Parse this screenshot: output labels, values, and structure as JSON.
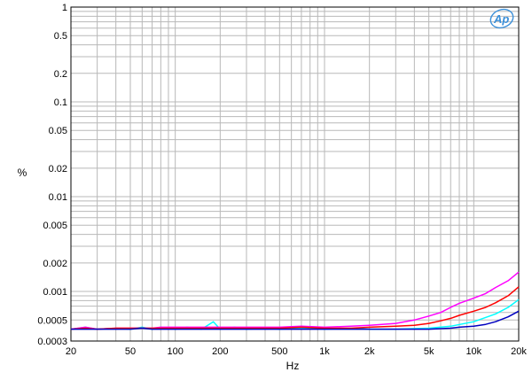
{
  "chart_data": {
    "type": "line",
    "title": "",
    "xlabel": "Hz",
    "ylabel": "%",
    "xscale": "log",
    "yscale": "log",
    "xlim": [
      20,
      20000
    ],
    "ylim": [
      0.0003,
      1
    ],
    "grid": true,
    "logo": "Ap",
    "x_ticks": [
      {
        "value": 20,
        "label": "20"
      },
      {
        "value": 50,
        "label": "50"
      },
      {
        "value": 100,
        "label": "100"
      },
      {
        "value": 200,
        "label": "200"
      },
      {
        "value": 500,
        "label": "500"
      },
      {
        "value": 1000,
        "label": "1k"
      },
      {
        "value": 2000,
        "label": "2k"
      },
      {
        "value": 5000,
        "label": "5k"
      },
      {
        "value": 10000,
        "label": "10k"
      },
      {
        "value": 20000,
        "label": "20k"
      }
    ],
    "y_ticks": [
      {
        "value": 1,
        "label": "1"
      },
      {
        "value": 0.5,
        "label": "0.5"
      },
      {
        "value": 0.2,
        "label": "0.2"
      },
      {
        "value": 0.1,
        "label": "0.1"
      },
      {
        "value": 0.05,
        "label": "0.05"
      },
      {
        "value": 0.02,
        "label": "0.02"
      },
      {
        "value": 0.01,
        "label": "0.01"
      },
      {
        "value": 0.005,
        "label": "0.005"
      },
      {
        "value": 0.002,
        "label": "0.002"
      },
      {
        "value": 0.001,
        "label": "0.001"
      },
      {
        "value": 0.0005,
        "label": "0.0005"
      },
      {
        "value": 0.0003,
        "label": "0.0003"
      }
    ],
    "series": [
      {
        "color": "#00ffff",
        "points": [
          [
            20,
            0.0004
          ],
          [
            25,
            0.00042
          ],
          [
            30,
            0.0004
          ],
          [
            40,
            0.00041
          ],
          [
            50,
            0.0004
          ],
          [
            60,
            0.00042
          ],
          [
            70,
            0.0004
          ],
          [
            80,
            0.00042
          ],
          [
            100,
            0.0004
          ],
          [
            120,
            0.00042
          ],
          [
            150,
            0.0004
          ],
          [
            180,
            0.00048
          ],
          [
            200,
            0.0004
          ],
          [
            250,
            0.00042
          ],
          [
            300,
            0.0004
          ],
          [
            400,
            0.00041
          ],
          [
            500,
            0.0004
          ],
          [
            700,
            0.00041
          ],
          [
            1000,
            0.0004
          ],
          [
            1500,
            0.00041
          ],
          [
            2000,
            0.0004
          ],
          [
            3000,
            0.0004
          ],
          [
            5000,
            0.00041
          ],
          [
            7000,
            0.00043
          ],
          [
            10000,
            0.00048
          ],
          [
            14000,
            0.00058
          ],
          [
            17000,
            0.00068
          ],
          [
            20000,
            0.00082
          ]
        ]
      },
      {
        "color": "#ff00ff",
        "points": [
          [
            20,
            0.0004
          ],
          [
            25,
            0.00042
          ],
          [
            30,
            0.0004
          ],
          [
            40,
            0.00041
          ],
          [
            50,
            0.00041
          ],
          [
            60,
            0.00041
          ],
          [
            70,
            0.00041
          ],
          [
            80,
            0.00042
          ],
          [
            100,
            0.00042
          ],
          [
            150,
            0.00042
          ],
          [
            200,
            0.00042
          ],
          [
            300,
            0.00042
          ],
          [
            500,
            0.00042
          ],
          [
            700,
            0.00043
          ],
          [
            1000,
            0.00042
          ],
          [
            1500,
            0.00043
          ],
          [
            2000,
            0.00044
          ],
          [
            3000,
            0.00046
          ],
          [
            4000,
            0.0005
          ],
          [
            5000,
            0.00055
          ],
          [
            6000,
            0.0006
          ],
          [
            7000,
            0.00068
          ],
          [
            8000,
            0.00075
          ],
          [
            10000,
            0.00085
          ],
          [
            12000,
            0.00095
          ],
          [
            14000,
            0.0011
          ],
          [
            17000,
            0.0013
          ],
          [
            20000,
            0.0016
          ]
        ]
      },
      {
        "color": "#ff0000",
        "points": [
          [
            20,
            0.0004
          ],
          [
            25,
            0.00041
          ],
          [
            30,
            0.0004
          ],
          [
            40,
            0.00041
          ],
          [
            50,
            0.00041
          ],
          [
            60,
            0.00041
          ],
          [
            70,
            0.00041
          ],
          [
            80,
            0.00041
          ],
          [
            100,
            0.00041
          ],
          [
            150,
            0.00041
          ],
          [
            200,
            0.00041
          ],
          [
            300,
            0.00041
          ],
          [
            500,
            0.00041
          ],
          [
            700,
            0.00042
          ],
          [
            1000,
            0.00041
          ],
          [
            1500,
            0.00041
          ],
          [
            2000,
            0.00042
          ],
          [
            3000,
            0.00043
          ],
          [
            4000,
            0.00044
          ],
          [
            5000,
            0.00046
          ],
          [
            6000,
            0.00049
          ],
          [
            7000,
            0.00052
          ],
          [
            8000,
            0.00056
          ],
          [
            10000,
            0.00062
          ],
          [
            12000,
            0.00068
          ],
          [
            14000,
            0.00076
          ],
          [
            17000,
            0.0009
          ],
          [
            20000,
            0.00112
          ]
        ]
      },
      {
        "color": "#0000c0",
        "points": [
          [
            20,
            0.0004
          ],
          [
            25,
            0.0004
          ],
          [
            30,
            0.0004
          ],
          [
            40,
            0.0004
          ],
          [
            50,
            0.0004
          ],
          [
            60,
            0.00041
          ],
          [
            70,
            0.0004
          ],
          [
            80,
            0.0004
          ],
          [
            100,
            0.0004
          ],
          [
            150,
            0.0004
          ],
          [
            200,
            0.0004
          ],
          [
            300,
            0.0004
          ],
          [
            500,
            0.0004
          ],
          [
            700,
            0.0004
          ],
          [
            1000,
            0.0004
          ],
          [
            1500,
            0.0004
          ],
          [
            2000,
            0.0004
          ],
          [
            3000,
            0.0004
          ],
          [
            5000,
            0.0004
          ],
          [
            7000,
            0.00041
          ],
          [
            8000,
            0.00042
          ],
          [
            10000,
            0.00043
          ],
          [
            12000,
            0.00045
          ],
          [
            14000,
            0.00048
          ],
          [
            17000,
            0.00054
          ],
          [
            20000,
            0.00062
          ]
        ]
      }
    ]
  }
}
